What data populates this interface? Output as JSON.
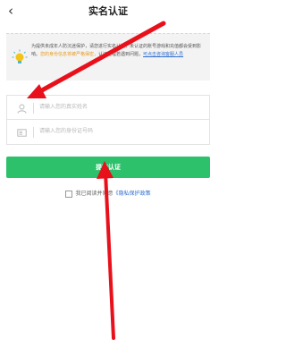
{
  "header": {
    "back_icon": "chevron-left-icon",
    "title": "实名认证"
  },
  "notice": {
    "icon": "lightbulb-icon",
    "text_main": "为提供未成年人防沉迷保护，请您进行实名认证，未认证的账号游戏和充值都会受到影响。",
    "text_highlight": "您的身份信息将被严格保密，",
    "text_tail": "认证过程若遇到问题，",
    "link_label": "可点击咨询客服人员"
  },
  "form": {
    "name_icon": "user-icon",
    "name_placeholder": "请输入您的真实姓名",
    "id_icon": "id-card-icon",
    "id_placeholder": "请输入您的身份证号码"
  },
  "submit_label": "提交认证",
  "agreement": {
    "prefix": "我已阅读并同意",
    "policy_link": "《隐私保护政策"
  },
  "colors": {
    "primary_green": "#2cc16a",
    "link_blue": "#2f6fd0",
    "highlight_orange": "#e89a1a",
    "annotation_red": "#e8101b"
  }
}
